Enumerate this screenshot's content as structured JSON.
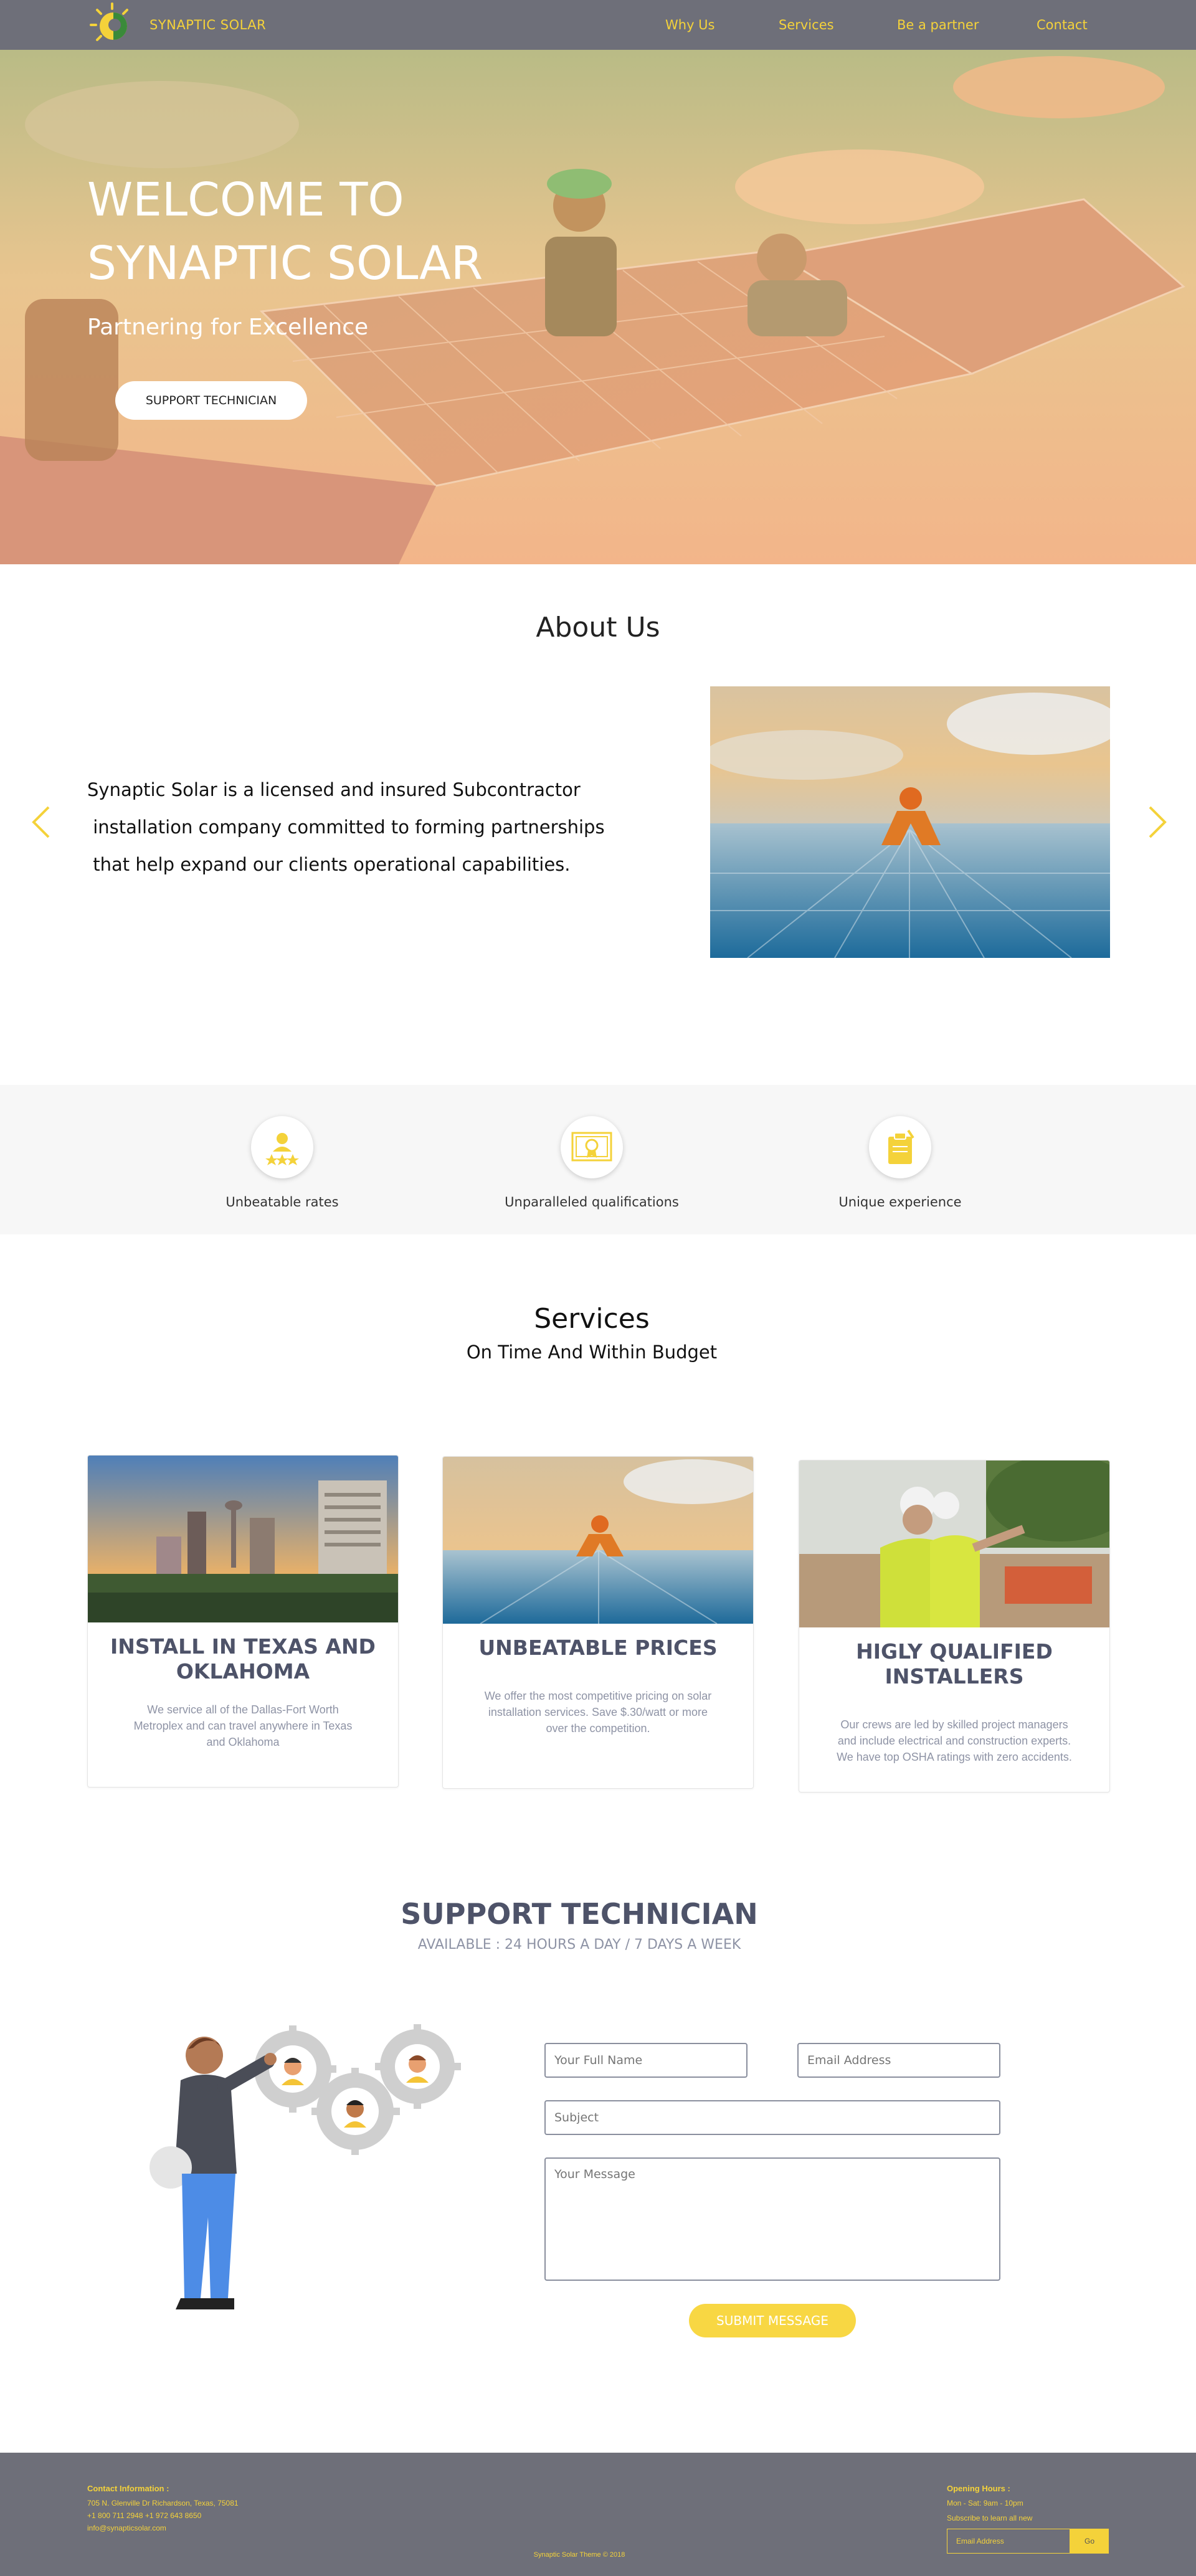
{
  "nav": {
    "brand": "SYNAPTIC SOLAR",
    "links": [
      "Why Us",
      "Services",
      "Be a partner",
      "Contact"
    ]
  },
  "hero": {
    "title_line1": "WELCOME TO",
    "title_line2": "SYNAPTIC SOLAR",
    "subtitle": "Partnering for Excellence",
    "button": "SUPPORT TECHNICIAN"
  },
  "about": {
    "title": "About Us",
    "lines": [
      "Synaptic Solar is a licensed and insured Subcontractor",
      " installation company committed to forming partnerships",
      " that help expand our clients operational capabilities."
    ]
  },
  "features": [
    {
      "label": "Unbeatable rates",
      "icon": "rating-person-icon"
    },
    {
      "label": "Unparalleled qualifications",
      "icon": "certificate-icon"
    },
    {
      "label": "Unique experience",
      "icon": "clipboard-icon"
    }
  ],
  "services": {
    "title": "Services",
    "subtitle": "On Time And Within Budget",
    "cards": [
      {
        "title": "INSTALL IN TEXAS AND OKLAHOMA",
        "text": "We service all of the Dallas-Fort Worth Metroplex and can travel anywhere in Texas and Oklahoma"
      },
      {
        "title": "UNBEATABLE PRICES",
        "text": "We offer the most competitive pricing on solar installation services. Save $.30/watt or more over the competition."
      },
      {
        "title": "HIGLY QUALIFIED INSTALLERS",
        "text": "Our crews are led by skilled project managers and include electrical and construction experts. We have top OSHA ratings with zero accidents."
      }
    ]
  },
  "support": {
    "title": "SUPPORT TECHNICIAN",
    "subtitle": "AVAILABLE : 24 HOURS A DAY / 7 DAYS A WEEK",
    "name_placeholder": "Your Full Name",
    "email_placeholder": "Email Address",
    "subject_placeholder": "Subject",
    "message_placeholder": "Your Message",
    "submit": "SUBMIT MESSAGE"
  },
  "footer": {
    "contact_heading": "Contact Information :",
    "address": "705 N. Glenville Dr Richardson, Texas, 75081",
    "phones": "+1 800 711 2948 +1 972 643 8650",
    "email": "info@synapticsolar.com",
    "hours_heading": "Opening Hours :",
    "hours": "Mon - Sat: 9am - 10pm",
    "subscribe_text": "Subscribe to learn all new",
    "subscribe_placeholder": "Email Address",
    "subscribe_button": "Go",
    "copyright": "Synaptic Solar Theme © 2018"
  },
  "colors": {
    "accent": "#f4d23a",
    "nav_bg": "#6e6f79",
    "heading": "#4e5369"
  }
}
